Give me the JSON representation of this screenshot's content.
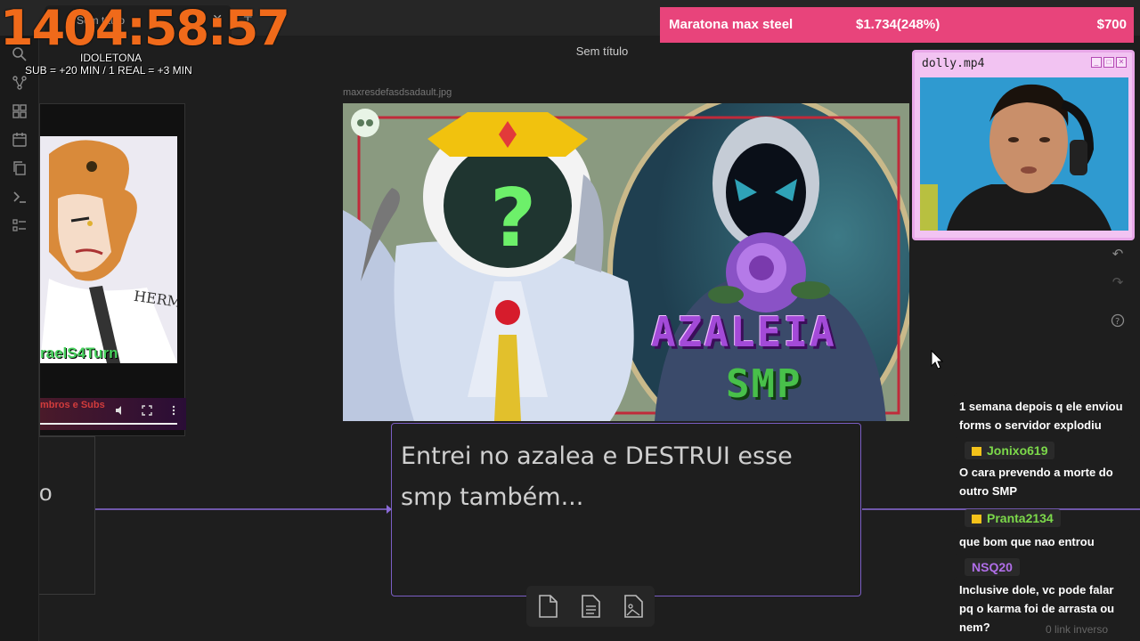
{
  "stream": {
    "timer": "1404:58:57",
    "timer_title": "IDOLETONA",
    "timer_rule": "SUB = +20  MIN / 1 REAL = +3 MIN",
    "goal_name": "Maratona max steel",
    "goal_amount": "$1.734(248%)",
    "goal_target": "$700",
    "cam_title": "dolly.mp4"
  },
  "app": {
    "tab_title": "Sem título",
    "view_title": "Sem título",
    "image_filename": "maxresdefasdsadault.jpg",
    "text_card": "Entrei no azalea e DESTRUI esse smp também...",
    "partial_node_text": "o",
    "backlinks": "0 link inverso"
  },
  "left_card": {
    "hermes_text": "HERMES",
    "handle": "raelS4Turn",
    "note": "mbros e Subs"
  },
  "thumbnail": {
    "title_1": "AZALEIA",
    "title_2": "SMP"
  },
  "chat": {
    "messages": [
      {
        "user": "",
        "text": "1 semana depois q ele enviou forms o servidor explodiu"
      },
      {
        "user": "Jonixo619",
        "text": "O cara prevendo a morte do outro SMP",
        "color": "#7cd94a",
        "crown": true
      },
      {
        "user": "Pranta2134",
        "text": "que bom que nao entrou",
        "color": "#7cd94a",
        "crown": true
      },
      {
        "user": "NSQ20",
        "text": "Inclusive dole, vc pode falar pq o karma foi de arrasta ou nem?",
        "color": "#b06ee8",
        "crown": false
      }
    ]
  },
  "icons": {
    "ribbon": [
      "search-icon",
      "graph-icon",
      "grid-icon",
      "calendar-icon",
      "copy-icon",
      "terminal-icon",
      "list-icon"
    ],
    "right_toolbar": [
      "undo-icon",
      "redo-icon",
      "help-icon"
    ],
    "bottom_toolbar": [
      "file-icon",
      "note-icon",
      "image-file-icon"
    ]
  }
}
